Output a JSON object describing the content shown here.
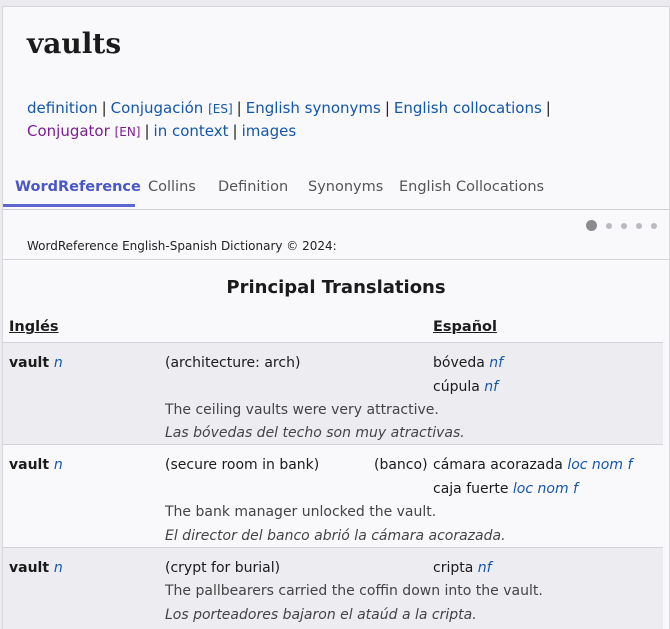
{
  "headword": "vaults",
  "links": [
    {
      "label": "definition",
      "tag": ""
    },
    {
      "label": "Conjugación",
      "tag": "[ES]"
    },
    {
      "label": "English synonyms",
      "tag": ""
    },
    {
      "label": "English collocations",
      "tag": ""
    },
    {
      "label": "Conjugator",
      "tag": "[EN]"
    },
    {
      "label": "in context",
      "tag": ""
    },
    {
      "label": "images",
      "tag": ""
    }
  ],
  "tabs": [
    "WordReference",
    "Collins",
    "Definition",
    "Synonyms",
    "English Collocations"
  ],
  "copyright": "WordReference English-Spanish Dictionary © 2024:",
  "section_title": "Principal Translations",
  "col_en": "Inglés",
  "col_es": "Español",
  "entries": [
    {
      "word": "vault",
      "pos": "n",
      "sense": "(architecture: arch)",
      "note": "",
      "translations": [
        {
          "term": "bóveda",
          "pos": "nf"
        },
        {
          "term": "cúpula",
          "pos": "nf"
        }
      ],
      "example_en": "The ceiling vaults were very attractive.",
      "example_es": "Las bóvedas del techo son muy atractivas."
    },
    {
      "word": "vault",
      "pos": "n",
      "sense": "(secure room in bank)",
      "note": "(banco)",
      "translations": [
        {
          "term": "cámara acorazada",
          "pos": "loc nom f"
        },
        {
          "term": "caja fuerte",
          "pos": "loc nom f"
        }
      ],
      "example_en": "The bank manager unlocked the vault.",
      "example_es": "El director del banco abrió la cámara acorazada."
    },
    {
      "word": "vault",
      "pos": "n",
      "sense": "(crypt for burial)",
      "note": "",
      "translations": [
        {
          "term": "cripta",
          "pos": "nf"
        }
      ],
      "example_en": "The pallbearers carried the coffin down into the vault.",
      "example_es": "Los porteadores bajaron el ataúd a la cripta."
    }
  ]
}
